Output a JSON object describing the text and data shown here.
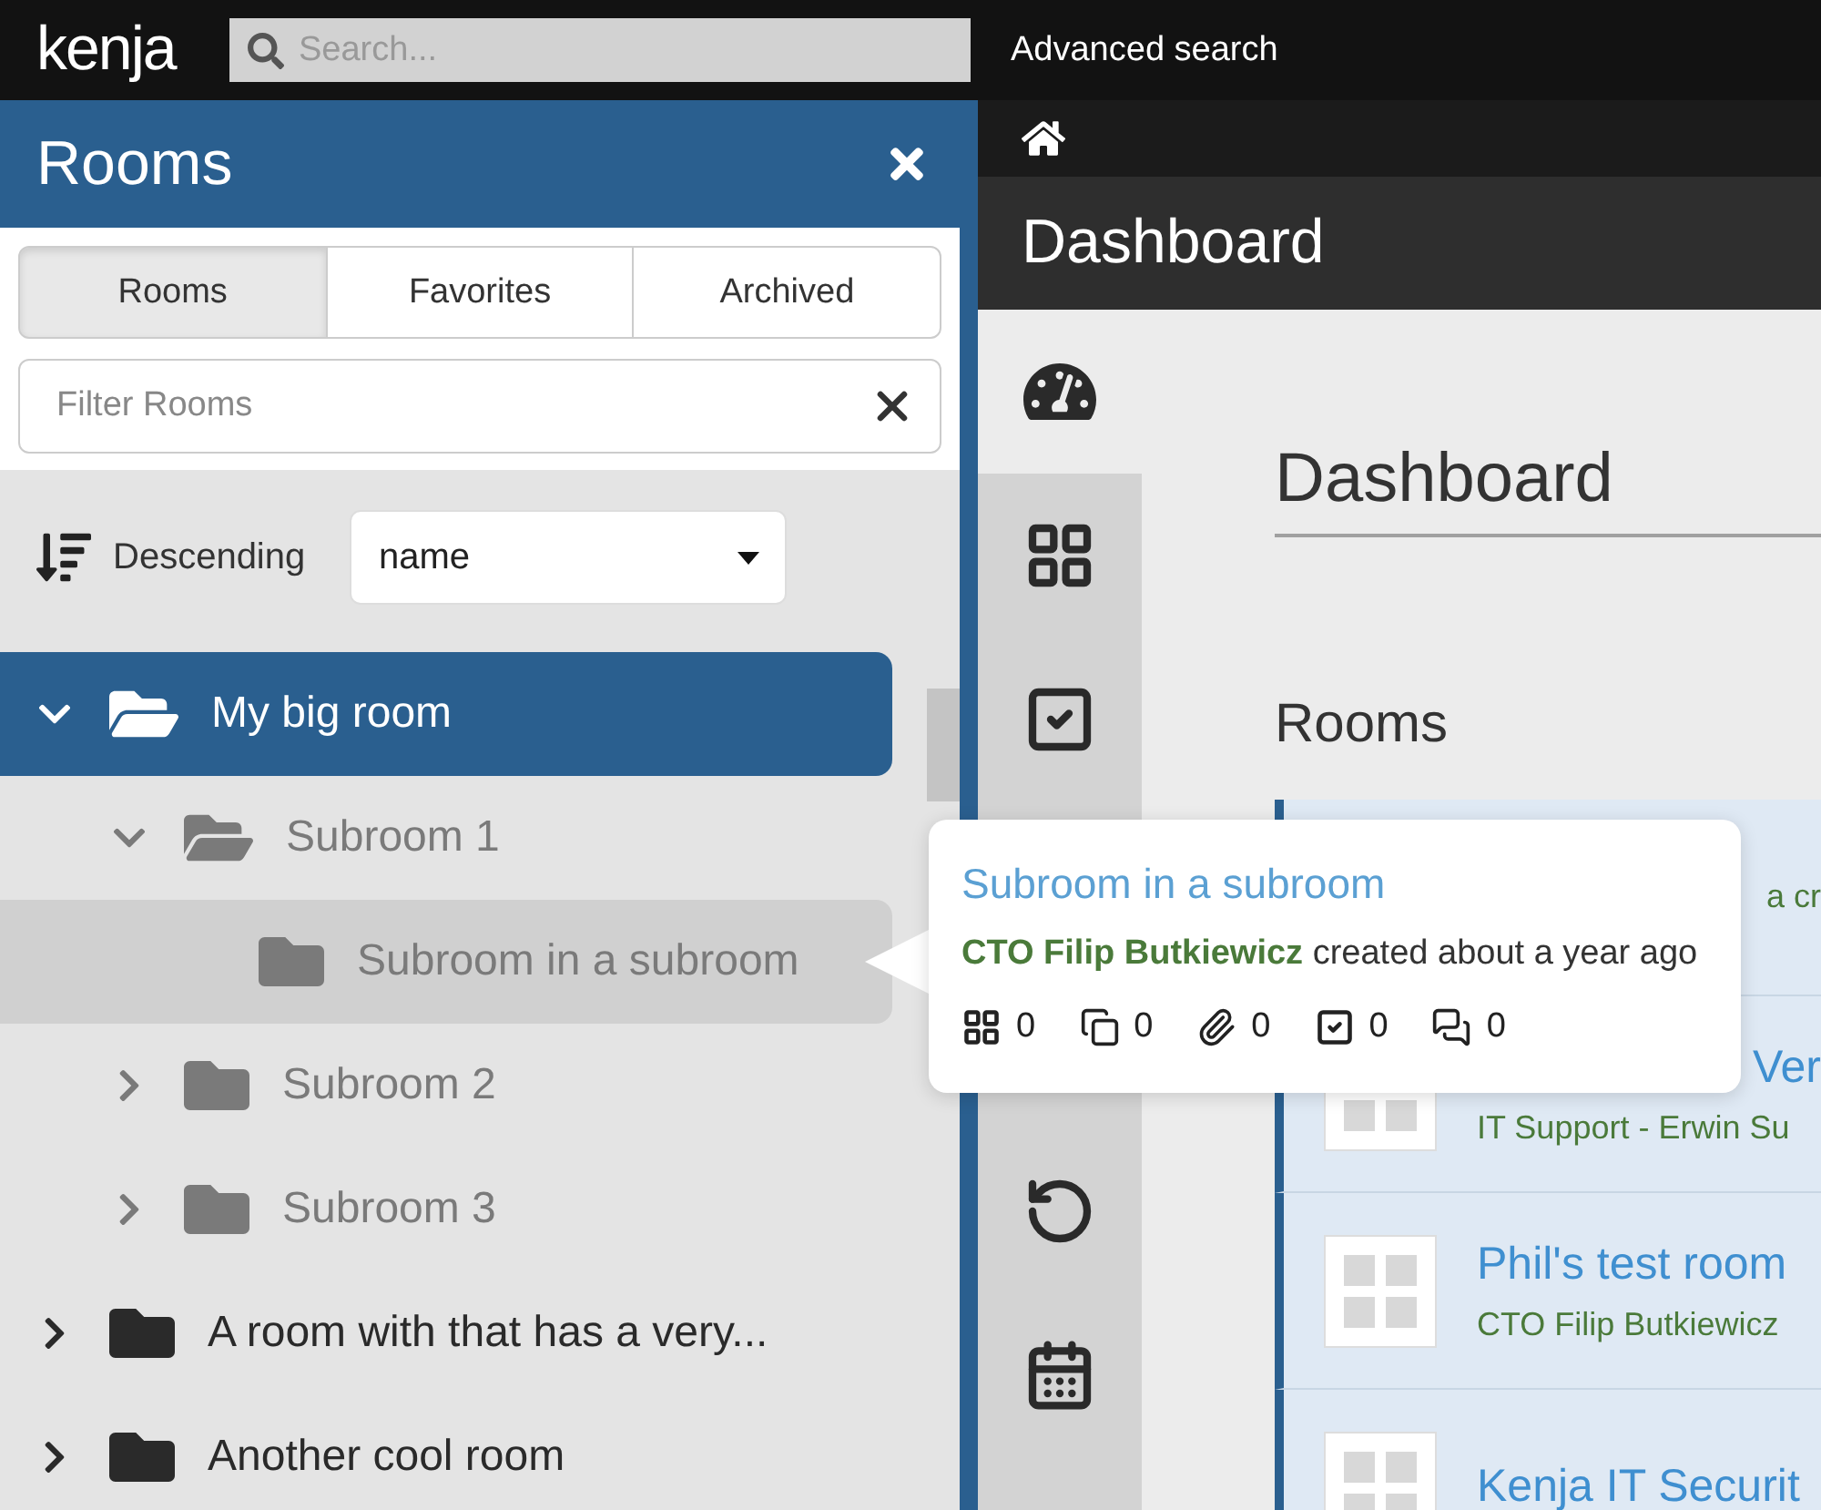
{
  "top_bar": {
    "logo": "kenja",
    "search": {
      "placeholder": "Search..."
    },
    "advanced_search": "Advanced search"
  },
  "rooms_panel": {
    "title": "Rooms",
    "tabs": [
      {
        "label": "Rooms",
        "selected": true
      },
      {
        "label": "Favorites",
        "selected": false
      },
      {
        "label": "Archived",
        "selected": false
      }
    ],
    "filter": {
      "placeholder": "Filter Rooms"
    },
    "sort": {
      "order": "Descending",
      "field": "name"
    },
    "tree": [
      {
        "label": "My big room",
        "selected": true,
        "expanded": true,
        "has_children": true,
        "children": [
          {
            "label": "Subroom 1",
            "selected": false,
            "expanded": true,
            "has_children": true,
            "children": [
              {
                "label": "Subroom in a subroom",
                "selected": false,
                "expanded": false,
                "has_children": false,
                "hovered": true
              }
            ]
          },
          {
            "label": "Subroom 2",
            "selected": false,
            "expanded": false,
            "has_children": true
          },
          {
            "label": "Subroom 3",
            "selected": false,
            "expanded": false,
            "has_children": true
          }
        ]
      },
      {
        "label": "A room with that has a very...",
        "selected": false,
        "expanded": false,
        "has_children": true
      },
      {
        "label": "Another cool room",
        "selected": false,
        "expanded": false,
        "has_children": true
      }
    ]
  },
  "main": {
    "page_title": "Dashboard",
    "icon_bar": {
      "upper": [
        {
          "kind": "gauge",
          "selected": true
        },
        {
          "kind": "grid",
          "selected": false
        },
        {
          "kind": "check",
          "selected": false
        }
      ],
      "lower": [
        {
          "kind": "undo",
          "selected": false
        },
        {
          "kind": "calendar",
          "selected": false
        }
      ]
    },
    "heading": "Dashboard",
    "rooms_heading": "Rooms",
    "cards": [
      {
        "subtitle_tail": "a cr"
      },
      {
        "title_tail": "Ver",
        "subtitle": "IT Support - Erwin Su"
      },
      {
        "title": "Phil's test room",
        "subtitle": "CTO Filip Butkiewicz"
      },
      {
        "title": "Kenja IT Securit"
      }
    ]
  },
  "tooltip": {
    "title": "Subroom in a subroom",
    "author": "CTO Filip Butkiewicz",
    "action": "created about a year ago",
    "stats": [
      {
        "kind": "grid",
        "count": "0"
      },
      {
        "kind": "copy",
        "count": "0"
      },
      {
        "kind": "attachment",
        "count": "0"
      },
      {
        "kind": "check",
        "count": "0"
      },
      {
        "kind": "chat",
        "count": "0"
      }
    ]
  }
}
